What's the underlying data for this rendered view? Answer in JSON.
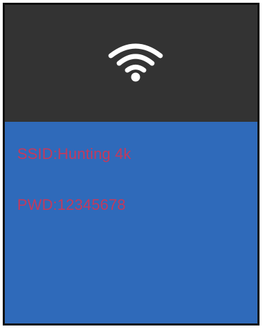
{
  "header": {
    "icon": "wifi-icon",
    "background_color": "#333333",
    "icon_color": "#ffffff"
  },
  "network": {
    "ssid_text": "SSID:Hunting 4k",
    "password_text": "PWD:12345678"
  },
  "colors": {
    "panel_background": "#2f6aba",
    "text": "#c33a5d",
    "border": "#0d0d0d"
  }
}
